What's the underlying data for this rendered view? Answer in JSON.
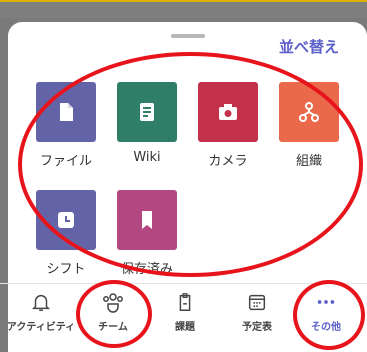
{
  "header": {
    "sort_label": "並べ替え"
  },
  "apps": [
    {
      "label": "ファイル",
      "color": "#6264a7",
      "icon": "file-icon"
    },
    {
      "label": "Wiki",
      "color": "#2f7e67",
      "icon": "wiki-icon"
    },
    {
      "label": "カメラ",
      "color": "#c4314b",
      "icon": "camera-icon"
    },
    {
      "label": "組織",
      "color": "#e9694a",
      "icon": "org-chart-icon"
    },
    {
      "label": "シフト",
      "color": "#6264a7",
      "icon": "shifts-icon"
    },
    {
      "label": "保存済み",
      "color": "#b24782",
      "icon": "bookmark-icon"
    }
  ],
  "bottom_nav": [
    {
      "label": "アクティビティ",
      "icon": "bell-icon"
    },
    {
      "label": "チーム",
      "icon": "teams-icon"
    },
    {
      "label": "課題",
      "icon": "assignments-icon"
    },
    {
      "label": "予定表",
      "icon": "calendar-icon"
    },
    {
      "label": "その他",
      "icon": "more-icon",
      "active": true
    }
  ],
  "colors": {
    "accent": "#5b5fc7",
    "annotation": "#e8141c"
  }
}
